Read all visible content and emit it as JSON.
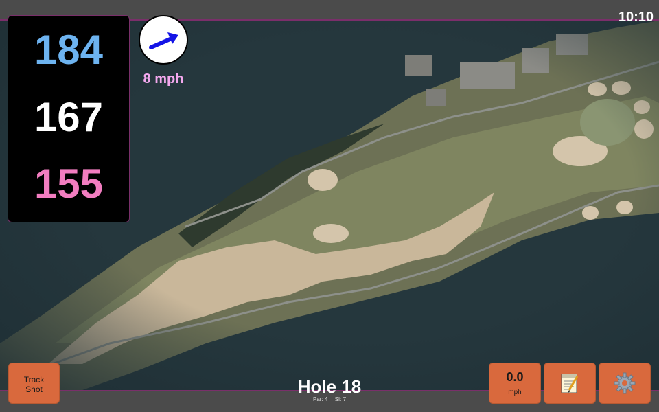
{
  "status": {
    "time": "10:10"
  },
  "distances": {
    "back": "184",
    "middle": "167",
    "front": "155"
  },
  "wind": {
    "speed": "8 mph",
    "direction_icon": "wind-arrow-icon",
    "arrow_color": "#1414e6"
  },
  "hole": {
    "title": "Hole 18",
    "par": "Par: 4",
    "stroke_index": "SI: 7"
  },
  "buttons": {
    "track_shot": {
      "line1": "Track",
      "line2": "Shot"
    },
    "speed": {
      "value": "0.0",
      "unit": "mph"
    },
    "notes": {
      "icon": "notepad-icon"
    },
    "settings": {
      "icon": "gear-icon"
    }
  },
  "colors": {
    "back_distance": "#6db3f0",
    "middle_distance": "#ffffff",
    "front_distance": "#f27dc0",
    "wind_text": "#f3a8ee",
    "button": "#d9693d",
    "accent_border": "#7a2f6a"
  }
}
